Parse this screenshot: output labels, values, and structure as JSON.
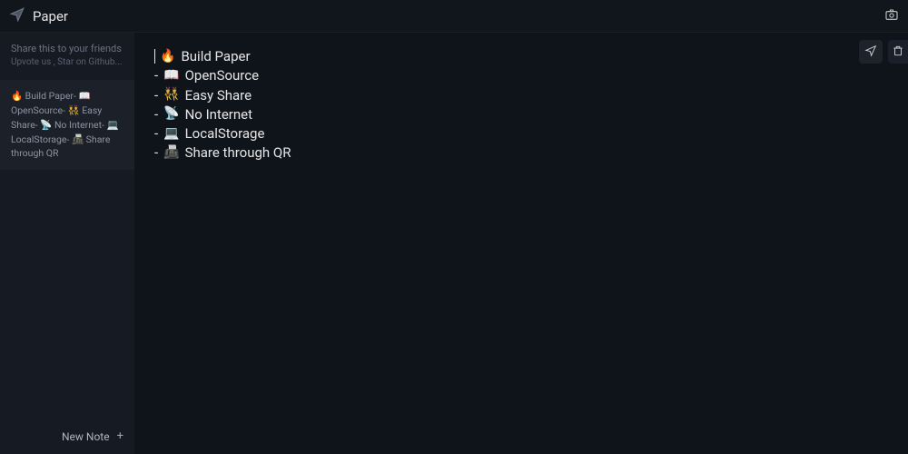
{
  "app": {
    "title": "Paper"
  },
  "topbar_icons": {
    "camera": "camera-icon"
  },
  "sidebar": {
    "share_line1": "Share this to your friends",
    "share_line2": "Upvote us , Star on Github...",
    "preview_text": "🔥 Build Paper- 📖 OpenSource- 👯 Easy Share- 📡 No Internet- 💻 LocalStorage- 📠 Share through QR",
    "new_note_label": "New Note"
  },
  "editor": {
    "lines": [
      {
        "prefix": "",
        "emoji": "🔥",
        "text": "Build Paper"
      },
      {
        "prefix": "-",
        "emoji": "📖",
        "text": "OpenSource"
      },
      {
        "prefix": "-",
        "emoji": "👯",
        "text": "Easy Share"
      },
      {
        "prefix": "-",
        "emoji": "📡",
        "text": "No Internet"
      },
      {
        "prefix": "-",
        "emoji": "💻",
        "text": "LocalStorage"
      },
      {
        "prefix": "-",
        "emoji": "📠",
        "text": "Share through QR"
      }
    ]
  },
  "editor_actions": {
    "send": "send-icon",
    "delete": "trash-icon"
  }
}
